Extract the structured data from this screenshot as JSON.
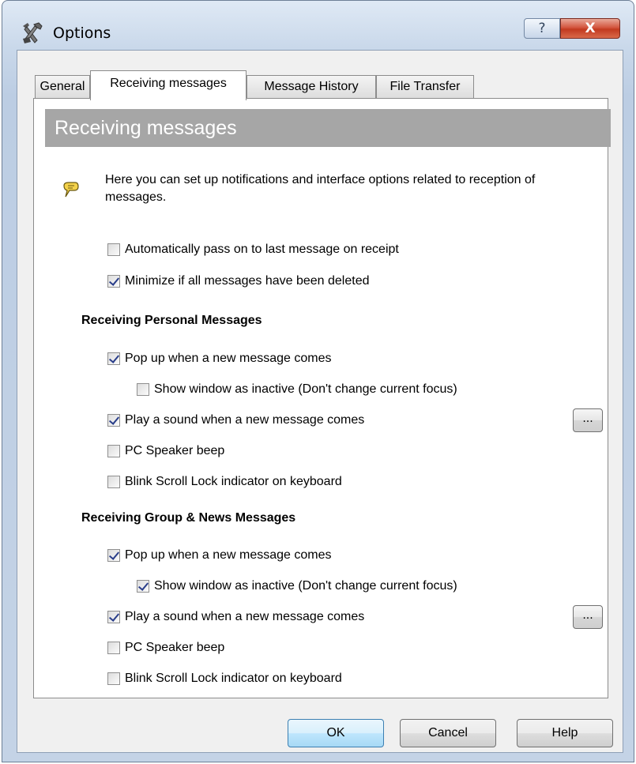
{
  "window": {
    "title": "Options",
    "help_label": "?",
    "close_label": "X"
  },
  "tabs": [
    {
      "label": "General",
      "active": false
    },
    {
      "label": "Receiving messages",
      "active": true
    },
    {
      "label": "Message History",
      "active": false
    },
    {
      "label": "File Transfer",
      "active": false
    }
  ],
  "panel": {
    "header": "Receiving messages",
    "intro": "Here you can set up notifications and interface options related to reception of messages.",
    "general_options": [
      {
        "label": "Automatically pass on to last message on receipt",
        "checked": false
      },
      {
        "label": "Minimize if all messages have been deleted",
        "checked": true
      }
    ],
    "personal": {
      "title": "Receiving Personal Messages",
      "options": [
        {
          "label": "Pop up when a new message comes",
          "checked": true
        },
        {
          "label": "Show window as inactive (Don't change current focus)",
          "checked": false
        },
        {
          "label": "Play a sound when a new message comes",
          "checked": true
        },
        {
          "label": "PC Speaker beep",
          "checked": false
        },
        {
          "label": "Blink Scroll Lock indicator on keyboard",
          "checked": false
        }
      ],
      "browse_label": "..."
    },
    "group": {
      "title": "Receiving Group & News Messages",
      "options": [
        {
          "label": "Pop up when a new message comes",
          "checked": true
        },
        {
          "label": "Show window as inactive (Don't change current focus)",
          "checked": true
        },
        {
          "label": "Play a sound when a new message comes",
          "checked": true
        },
        {
          "label": "PC Speaker beep",
          "checked": false
        },
        {
          "label": "Blink Scroll Lock indicator on keyboard",
          "checked": false
        }
      ],
      "browse_label": "..."
    }
  },
  "buttons": {
    "ok": "OK",
    "cancel": "Cancel",
    "help": "Help"
  },
  "colors": {
    "header_bg": "#a6a6a6",
    "check_mark": "#2a3e8a",
    "close_button": "#c23a20"
  }
}
